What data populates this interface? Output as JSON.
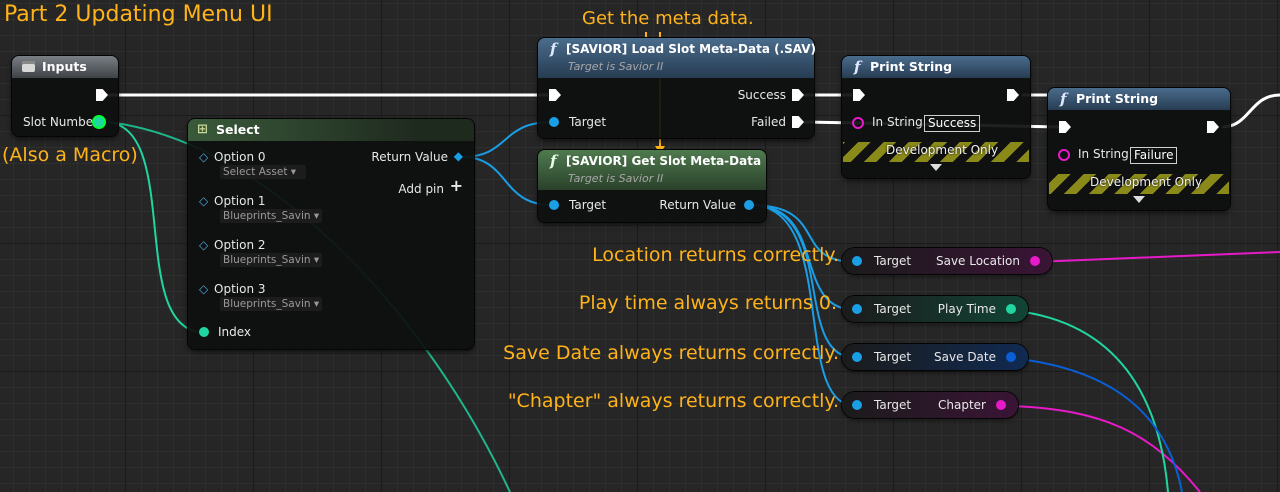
{
  "annotations": {
    "title": "Part 2  Updating Menu UI",
    "macro_note": "(Also a Macro)",
    "meta_note": "Get the meta data.",
    "location_note": "Location returns correctly.",
    "playtime_note": "Play time always returns 0.",
    "savedate_note": "Save Date always returns correctly.",
    "chapter_note": "\"Chapter\" always returns correctly."
  },
  "inputs_node": {
    "title": "Inputs",
    "slot_number": "Slot Number"
  },
  "select_node": {
    "title": "Select",
    "return_value": "Return Value",
    "add_pin": "Add pin",
    "index": "Index",
    "options": [
      {
        "label": "Option 0",
        "value": "Select Asset"
      },
      {
        "label": "Option 1",
        "value": "Blueprints_Savin"
      },
      {
        "label": "Option 2",
        "value": "Blueprints_Savin"
      },
      {
        "label": "Option 3",
        "value": "Blueprints_Savin"
      }
    ]
  },
  "load_node": {
    "title": "[SAVIOR] Load Slot Meta-Data (.SAV)",
    "subtitle": "Target is Savior II",
    "target": "Target",
    "success": "Success",
    "failed": "Failed"
  },
  "get_node": {
    "title": "[SAVIOR] Get Slot Meta-Data",
    "subtitle": "Target is Savior II",
    "target": "Target",
    "return_value": "Return Value"
  },
  "print1": {
    "title": "Print String",
    "in_string": "In String",
    "value": "Success",
    "dev": "Development Only"
  },
  "print2": {
    "title": "Print String",
    "in_string": "In String",
    "value": "Failure",
    "dev": "Development Only"
  },
  "getters": [
    {
      "target": "Target",
      "field": "Save Location",
      "color": "#e61ac8"
    },
    {
      "target": "Target",
      "field": "Play Time",
      "color": "#20d6a0"
    },
    {
      "target": "Target",
      "field": "Save Date",
      "color": "#0a5fd6"
    },
    {
      "target": "Target",
      "field": "Chapter",
      "color": "#e61ac8"
    }
  ],
  "colors": {
    "exec": "#ffffff",
    "object": "#1a9ee6",
    "int": "#20d6a0",
    "string": "#e61ac8",
    "struct": "#0a5fd6",
    "annotation": "#ffb31a"
  }
}
